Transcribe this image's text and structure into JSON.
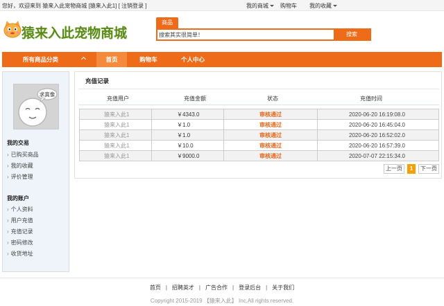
{
  "topbar": {
    "greeting": "您好，欢迎来到 猿来入此宠物商城",
    "user": "[猿来入此1]",
    "logout": "[ 注销登录 ]",
    "my_mall": "我的商城",
    "cart": "购物车",
    "favorites": "我的收藏"
  },
  "logo": {
    "text": "猿来入此宠物商城"
  },
  "search": {
    "tab_label": "商品",
    "value": "搜索其实很简单！",
    "button_label": "搜索"
  },
  "nav": {
    "category_label": "所有商品分类",
    "items": [
      {
        "label": "首页",
        "active": true
      },
      {
        "label": "购物车",
        "active": false
      },
      {
        "label": "个人中心",
        "active": false
      }
    ]
  },
  "sidebar": {
    "avatar_caption": "求真像",
    "section1_title": "我的交易",
    "section1_links": [
      "已购买商品",
      "我的收藏",
      "评价管理"
    ],
    "section2_title": "我的账户",
    "section2_links": [
      "个人资料",
      "用户充值",
      "充值记录",
      "密码修改",
      "收货地址"
    ]
  },
  "main": {
    "title": "充值记录",
    "columns": [
      "充值用户",
      "充值金额",
      "状态",
      "充值时间"
    ],
    "rows": [
      [
        "猿来入此1",
        "￥4343.0",
        "审核通过",
        "2020-06-20 16:19:08.0"
      ],
      [
        "猿来入此1",
        "￥1.0",
        "审核通过",
        "2020-06-20 16:45:04.0"
      ],
      [
        "猿来入此1",
        "￥1.0",
        "审核通过",
        "2020-06-20 16:52:02.0"
      ],
      [
        "猿来入此1",
        "￥10.0",
        "审核通过",
        "2020-06-20 16:57:39.0"
      ],
      [
        "猿来入此1",
        "￥9000.0",
        "审核通过",
        "2020-07-07 22:15:34.0"
      ]
    ],
    "pagination": {
      "prev": "上一页",
      "current": "1",
      "next": "下一页"
    }
  },
  "footer": {
    "links": [
      "首页",
      "招聘英才",
      "广告合作",
      "登录后台",
      "关于我们"
    ],
    "copyright": "Copyright 2015-2019 【猿来入此】 Inc,All rights reserved."
  },
  "colors": {
    "accent": "#ee6b1a",
    "status": "#e8671c",
    "pager_current": "#f5a000"
  }
}
